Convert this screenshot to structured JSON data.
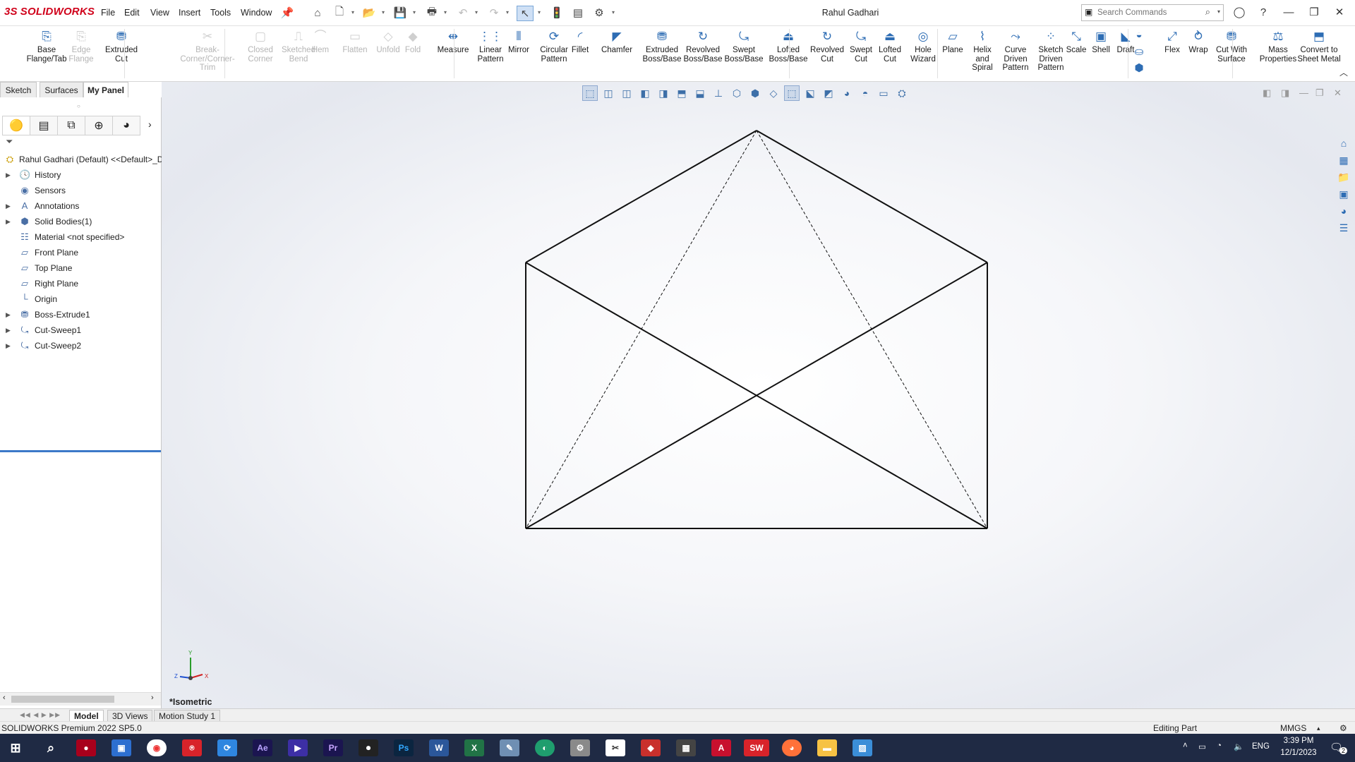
{
  "app": {
    "logo": "SOLIDWORKS",
    "window_title": "Rahul Gadhari",
    "menus": [
      "File",
      "Edit",
      "View",
      "Insert",
      "Tools",
      "Window"
    ],
    "search_placeholder": "Search Commands"
  },
  "commands": [
    {
      "label": "Base Flange/Tab",
      "enabled": true,
      "icon": "base-flange-icon"
    },
    {
      "label": "Edge Flange",
      "enabled": false,
      "icon": "edge-flange-icon"
    },
    {
      "label": "Extruded Cut",
      "enabled": true,
      "icon": "extruded-cut-icon"
    },
    {
      "label": "Break-Corner/Corner-Trim",
      "enabled": false,
      "icon": "break-corner-icon"
    },
    {
      "label": "Closed Corner",
      "enabled": false,
      "icon": "closed-corner-icon"
    },
    {
      "label": "Sketched Bend",
      "enabled": false,
      "icon": "sketched-bend-icon"
    },
    {
      "label": "Hem",
      "enabled": false,
      "icon": "hem-icon"
    },
    {
      "label": "Flatten",
      "enabled": false,
      "icon": "flatten-icon"
    },
    {
      "label": "Unfold",
      "enabled": false,
      "icon": "unfold-icon"
    },
    {
      "label": "Fold",
      "enabled": false,
      "icon": "fold-icon"
    },
    {
      "label": "Measure",
      "enabled": true,
      "icon": "measure-icon"
    },
    {
      "label": "Linear Pattern",
      "enabled": true,
      "icon": "linear-pattern-icon"
    },
    {
      "label": "Mirror",
      "enabled": true,
      "icon": "mirror-icon"
    },
    {
      "label": "Circular Pattern",
      "enabled": true,
      "icon": "circular-pattern-icon"
    },
    {
      "label": "Fillet",
      "enabled": true,
      "icon": "fillet-icon"
    },
    {
      "label": "Chamfer",
      "enabled": true,
      "icon": "chamfer-icon"
    },
    {
      "label": "Extruded Boss/Base",
      "enabled": true,
      "icon": "extruded-boss-icon"
    },
    {
      "label": "Revolved Boss/Base",
      "enabled": true,
      "icon": "revolved-boss-icon"
    },
    {
      "label": "Swept Boss/Base",
      "enabled": true,
      "icon": "swept-boss-icon"
    },
    {
      "label": "Lofted Boss/Base",
      "enabled": true,
      "icon": "lofted-boss-icon"
    },
    {
      "label": "Revolved Cut",
      "enabled": true,
      "icon": "revolved-cut-icon"
    },
    {
      "label": "Swept Cut",
      "enabled": true,
      "icon": "swept-cut-icon"
    },
    {
      "label": "Lofted Cut",
      "enabled": true,
      "icon": "lofted-cut-icon"
    },
    {
      "label": "Hole Wizard",
      "enabled": true,
      "icon": "hole-wizard-icon"
    },
    {
      "label": "Plane",
      "enabled": true,
      "icon": "plane-icon"
    },
    {
      "label": "Helix and Spiral",
      "enabled": true,
      "icon": "helix-icon"
    },
    {
      "label": "Curve Driven Pattern",
      "enabled": true,
      "icon": "curve-pattern-icon"
    },
    {
      "label": "Sketch Driven Pattern",
      "enabled": true,
      "icon": "sketch-pattern-icon"
    },
    {
      "label": "Scale",
      "enabled": true,
      "icon": "scale-icon"
    },
    {
      "label": "Shell",
      "enabled": true,
      "icon": "shell-icon"
    },
    {
      "label": "Draft",
      "enabled": true,
      "icon": "draft-icon"
    },
    {
      "label": "Flex",
      "enabled": true,
      "icon": "flex-icon"
    },
    {
      "label": "Wrap",
      "enabled": true,
      "icon": "wrap-icon"
    },
    {
      "label": "Cut With Surface",
      "enabled": true,
      "icon": "cut-surface-icon"
    },
    {
      "label": "Mass Properties",
      "enabled": true,
      "icon": "mass-properties-icon"
    },
    {
      "label": "Convert to Sheet Metal",
      "enabled": true,
      "icon": "convert-sheet-metal-icon"
    }
  ],
  "tabs": {
    "sketch": "Sketch",
    "surfaces": "Surfaces",
    "mypanel": "My Panel"
  },
  "tree": {
    "root": "Rahul Gadhari (Default) <<Default>_D",
    "items": [
      {
        "label": "History",
        "expandable": true,
        "icon": "history-icon"
      },
      {
        "label": "Sensors",
        "expandable": false,
        "icon": "sensors-icon"
      },
      {
        "label": "Annotations",
        "expandable": true,
        "icon": "annotations-icon"
      },
      {
        "label": "Solid Bodies(1)",
        "expandable": true,
        "icon": "solid-bodies-icon"
      },
      {
        "label": "Material <not specified>",
        "expandable": false,
        "icon": "material-icon"
      },
      {
        "label": "Front Plane",
        "expandable": false,
        "icon": "plane-icon"
      },
      {
        "label": "Top Plane",
        "expandable": false,
        "icon": "plane-icon"
      },
      {
        "label": "Right Plane",
        "expandable": false,
        "icon": "plane-icon"
      },
      {
        "label": "Origin",
        "expandable": false,
        "icon": "origin-icon"
      },
      {
        "label": "Boss-Extrude1",
        "expandable": true,
        "icon": "extrude-feature-icon"
      },
      {
        "label": "Cut-Sweep1",
        "expandable": true,
        "icon": "sweep-feature-icon"
      },
      {
        "label": "Cut-Sweep2",
        "expandable": true,
        "icon": "sweep-feature-icon"
      }
    ]
  },
  "graphics": {
    "view_label": "*Isometric",
    "triad": {
      "x": "X",
      "y": "Y",
      "z": "Z"
    }
  },
  "bottom_tabs": {
    "model": "Model",
    "views3d": "3D Views",
    "motion": "Motion Study 1"
  },
  "status": {
    "version": "SOLIDWORKS Premium 2022 SP5.0",
    "mode": "Editing Part",
    "units": "MMGS"
  },
  "taskbar": {
    "apps": [
      "Ae",
      "Pr",
      "Ps",
      "W",
      "X"
    ],
    "lang": "ENG",
    "time": "3:39 PM",
    "date": "12/1/2023",
    "notifications": "2"
  }
}
